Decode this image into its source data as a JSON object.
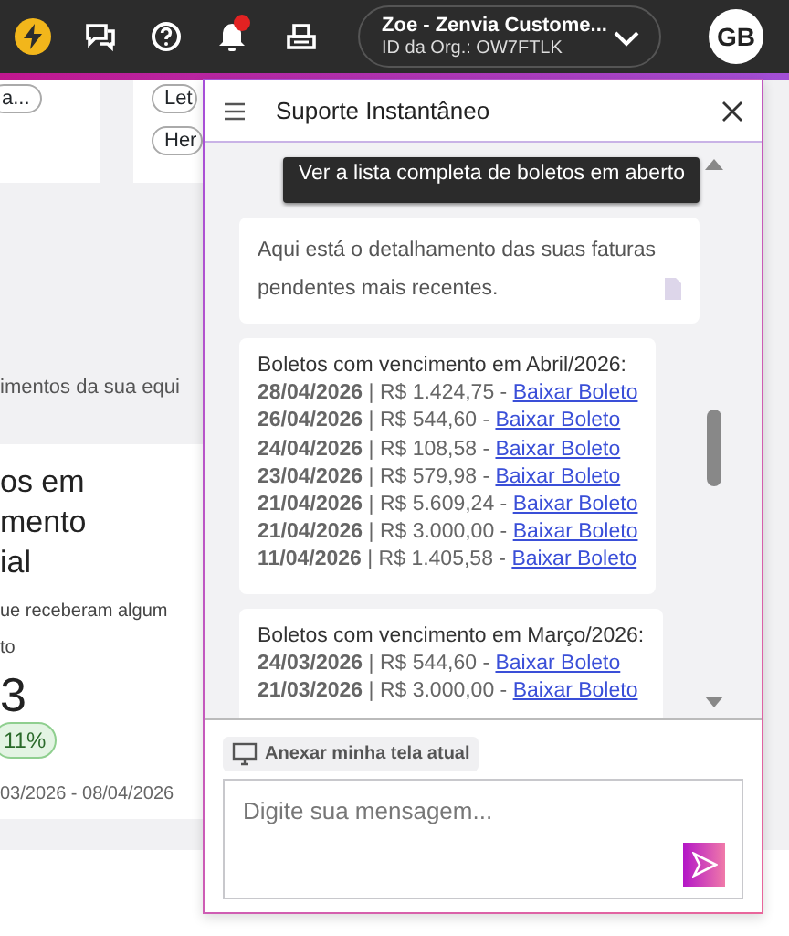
{
  "top_bar": {
    "notifications": {
      "has_unread": true
    },
    "org": {
      "name": "Zoe - Zenvia Custome...",
      "id": "ID da Org.: OW7FTLK"
    },
    "avatar": "GB"
  },
  "background": {
    "top_cards": [
      {
        "pills": [
          "a..."
        ]
      },
      {
        "pills": [
          "Let",
          "Her"
        ]
      }
    ],
    "subtitle": "imentos da sua equi",
    "metric_card": {
      "title_lines": [
        "os em",
        "mento",
        "ial"
      ],
      "description_lines": [
        "ue receberam algum",
        "to"
      ],
      "value": "3",
      "change": "11%",
      "period": "03/2026 - 08/04/2026"
    }
  },
  "chat": {
    "title": "Suporte Instantâneo",
    "messages": [
      {
        "kind": "user",
        "text": "Ver a lista completa de boletos em aberto"
      },
      {
        "kind": "bot_text",
        "text": "Aqui está o detalhamento das suas faturas pendentes mais recentes."
      },
      {
        "kind": "bot_list",
        "heading": "Boletos com vencimento em Abril/2026:",
        "items": [
          {
            "text": "**28/04/2026** | R$ 1.424,75 - ",
            "link": "Baixar Boleto"
          },
          {
            "text": "**26/04/2026** | R$ 544,60 - ",
            "link": "Baixar Boleto"
          },
          {
            "text": "**24/04/2026** | R$ 108,58 - ",
            "link": "Baixar Boleto"
          },
          {
            "text": "**23/04/2026** | R$ 579,98 - ",
            "link": "Baixar Boleto"
          },
          {
            "text": "**21/04/2026** | R$ 5.609,24 - ",
            "link": "Baixar Boleto"
          },
          {
            "text": "**21/04/2026** | R$ 3.000,00 - ",
            "link": "Baixar Boleto"
          },
          {
            "text": "**11/04/2026** | R$ 1.405,58 - ",
            "link": "Baixar Boleto"
          }
        ]
      },
      {
        "kind": "bot_list",
        "heading": "Boletos com vencimento em Março/2026:",
        "items": [
          {
            "text": "**24/03/2026** | R$ 544,60 - ",
            "link": "Baixar Boleto"
          },
          {
            "text": "**21/03/2026** | R$ 3.000,00 - ",
            "link": "Baixar Boleto"
          }
        ]
      }
    ],
    "attach_button": "Anexar minha tela atual",
    "input": {
      "placeholder": "Digite sua mensagem..."
    }
  }
}
